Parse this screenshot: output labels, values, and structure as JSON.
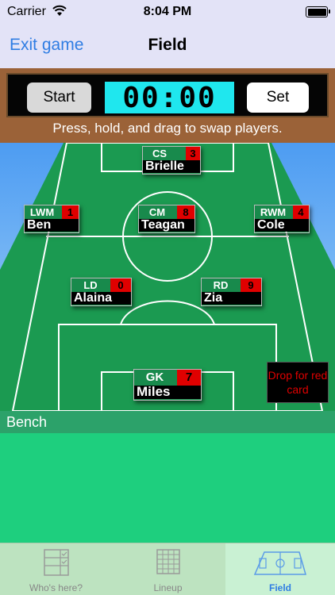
{
  "status_bar": {
    "carrier": "Carrier",
    "time": "8:04 PM"
  },
  "nav": {
    "back_label": "Exit game",
    "title": "Field"
  },
  "timer": {
    "start_label": "Start",
    "clock": "00:00",
    "set_label": "Set",
    "hint": "Press, hold, and drag to swap players."
  },
  "players": [
    {
      "pos": "CS",
      "num": "3",
      "name": "Brielle"
    },
    {
      "pos": "LWM",
      "num": "1",
      "name": "Ben"
    },
    {
      "pos": "CM",
      "num": "8",
      "name": "Teagan"
    },
    {
      "pos": "RWM",
      "num": "4",
      "name": "Cole"
    },
    {
      "pos": "LD",
      "num": "0",
      "name": "Alaina"
    },
    {
      "pos": "RD",
      "num": "9",
      "name": "Zia"
    },
    {
      "pos": "GK",
      "num": "7",
      "name": "Miles"
    }
  ],
  "red_card_drop": "Drop for red card",
  "bench": {
    "label": "Bench"
  },
  "tabs": [
    {
      "label": "Who's here?",
      "icon": "checklist-icon"
    },
    {
      "label": "Lineup",
      "icon": "grid-icon"
    },
    {
      "label": "Field",
      "icon": "field-icon"
    }
  ],
  "colors": {
    "accent": "#2f7de3",
    "panel_brown": "#9b6238",
    "clock_cyan": "#1fe7ee",
    "pitch_green": "#1ecf7e"
  }
}
